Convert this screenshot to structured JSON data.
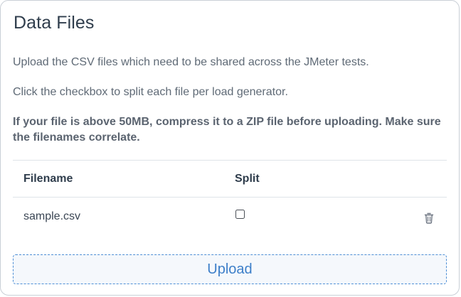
{
  "card": {
    "title": "Data Files",
    "description_1": "Upload the CSV files which need to be shared across the JMeter tests.",
    "description_2": "Click the checkbox to split each file per load generator.",
    "warning": "If your file is above 50MB, compress it to a ZIP file before uploading. Make sure the filenames correlate."
  },
  "table": {
    "columns": [
      "Filename",
      "Split"
    ],
    "rows": [
      {
        "filename": "sample.csv",
        "split": false,
        "delete_icon": "trash-icon"
      }
    ]
  },
  "upload_label": "Upload",
  "colors": {
    "accent": "#3d7fc9",
    "title": "#2f3d4c",
    "text": "#5f6a76",
    "border": "#c9cfd6"
  }
}
